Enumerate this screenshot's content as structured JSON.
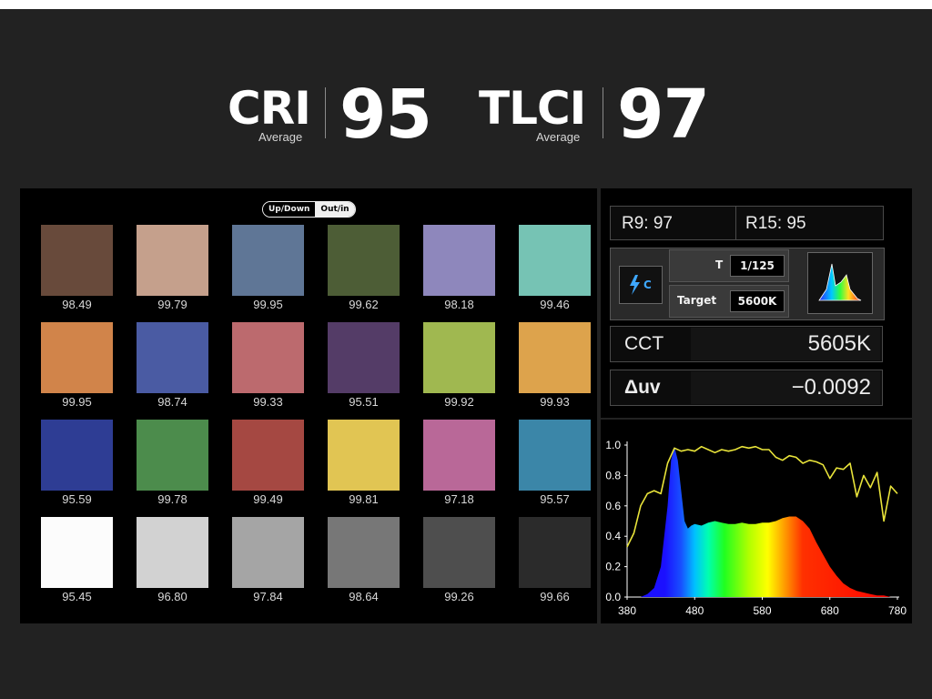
{
  "cri": {
    "label": "CRI",
    "sublabel": "Average",
    "value": "95"
  },
  "tlci": {
    "label": "TLCI",
    "sublabel": "Average",
    "value": "97"
  },
  "toggle": {
    "options": [
      "Up/Down",
      "Out/in"
    ],
    "active_index": 1
  },
  "swatches": [
    {
      "value": "98.49",
      "color": "#684a3b"
    },
    {
      "value": "99.79",
      "color": "#c5a08c"
    },
    {
      "value": "99.95",
      "color": "#5f7696"
    },
    {
      "value": "99.62",
      "color": "#4d5d36"
    },
    {
      "value": "98.18",
      "color": "#8e87bc"
    },
    {
      "value": "99.46",
      "color": "#76c3b4"
    },
    {
      "value": "99.95",
      "color": "#d1844a"
    },
    {
      "value": "98.74",
      "color": "#4a5ba3"
    },
    {
      "value": "99.33",
      "color": "#bc6a6e"
    },
    {
      "value": "95.51",
      "color": "#543c67"
    },
    {
      "value": "99.92",
      "color": "#a0b850"
    },
    {
      "value": "99.93",
      "color": "#dda34c"
    },
    {
      "value": "95.59",
      "color": "#2e3d94"
    },
    {
      "value": "99.78",
      "color": "#4c8c4c"
    },
    {
      "value": "99.49",
      "color": "#a54842"
    },
    {
      "value": "99.81",
      "color": "#e1c553"
    },
    {
      "value": "97.18",
      "color": "#b96898"
    },
    {
      "value": "95.57",
      "color": "#3b86a8"
    },
    {
      "value": "95.45",
      "color": "#fcfcfc"
    },
    {
      "value": "96.80",
      "color": "#d2d2d2"
    },
    {
      "value": "97.84",
      "color": "#a5a5a5"
    },
    {
      "value": "98.64",
      "color": "#777777"
    },
    {
      "value": "99.26",
      "color": "#4e4e4e"
    },
    {
      "value": "99.66",
      "color": "#2b2b2b"
    }
  ],
  "r9": "R9: 97",
  "r15": "R15: 95",
  "mode_icon_text": "C",
  "shutter": {
    "label": "T",
    "value": "1/125"
  },
  "target": {
    "label": "Target",
    "value": "5600K"
  },
  "cct": {
    "label": "CCT",
    "value": "5605K"
  },
  "duv": {
    "label": "Δuv",
    "value": "−0.0092"
  },
  "chart_data": {
    "type": "area",
    "title": "",
    "xlabel": "",
    "ylabel": "",
    "xlim": [
      380,
      780
    ],
    "ylim": [
      0,
      1.0
    ],
    "x_ticks": [
      "380",
      "480",
      "580",
      "680",
      "780"
    ],
    "y_ticks": [
      "0.0",
      "0.2",
      "0.4",
      "0.6",
      "0.8",
      "1.0"
    ],
    "series": [
      {
        "style": "spectrum-filled area",
        "x": [
          380,
          400,
          410,
          420,
          430,
          440,
          445,
          450,
          455,
          460,
          465,
          470,
          475,
          480,
          490,
          500,
          510,
          520,
          530,
          540,
          550,
          560,
          570,
          580,
          590,
          600,
          610,
          620,
          630,
          640,
          650,
          660,
          670,
          680,
          690,
          700,
          710,
          720,
          730,
          740,
          750,
          760,
          770,
          780
        ],
        "y": [
          0.0,
          0.0,
          0.02,
          0.06,
          0.2,
          0.6,
          0.9,
          0.99,
          0.9,
          0.7,
          0.5,
          0.45,
          0.47,
          0.48,
          0.47,
          0.49,
          0.5,
          0.49,
          0.48,
          0.48,
          0.49,
          0.48,
          0.48,
          0.49,
          0.49,
          0.5,
          0.52,
          0.53,
          0.53,
          0.5,
          0.45,
          0.36,
          0.28,
          0.2,
          0.14,
          0.09,
          0.06,
          0.04,
          0.03,
          0.02,
          0.01,
          0.01,
          0.0,
          0.0
        ]
      },
      {
        "style": "yellow line",
        "x": [
          380,
          390,
          400,
          410,
          420,
          430,
          440,
          450,
          460,
          470,
          480,
          490,
          500,
          510,
          520,
          530,
          540,
          550,
          560,
          570,
          580,
          590,
          600,
          610,
          620,
          630,
          640,
          650,
          660,
          670,
          680,
          690,
          700,
          710,
          720,
          730,
          740,
          750,
          760,
          770,
          780
        ],
        "y": [
          0.33,
          0.42,
          0.6,
          0.68,
          0.7,
          0.68,
          0.88,
          0.98,
          0.96,
          0.97,
          0.96,
          0.99,
          0.97,
          0.95,
          0.97,
          0.96,
          0.97,
          0.99,
          0.98,
          0.99,
          0.97,
          0.97,
          0.92,
          0.9,
          0.93,
          0.92,
          0.88,
          0.9,
          0.89,
          0.87,
          0.78,
          0.85,
          0.84,
          0.88,
          0.66,
          0.8,
          0.72,
          0.82,
          0.5,
          0.73,
          0.68
        ]
      }
    ],
    "colors": {
      "line": "#e9e43a",
      "axis": "#ffffff",
      "fill": "spectrum"
    }
  }
}
